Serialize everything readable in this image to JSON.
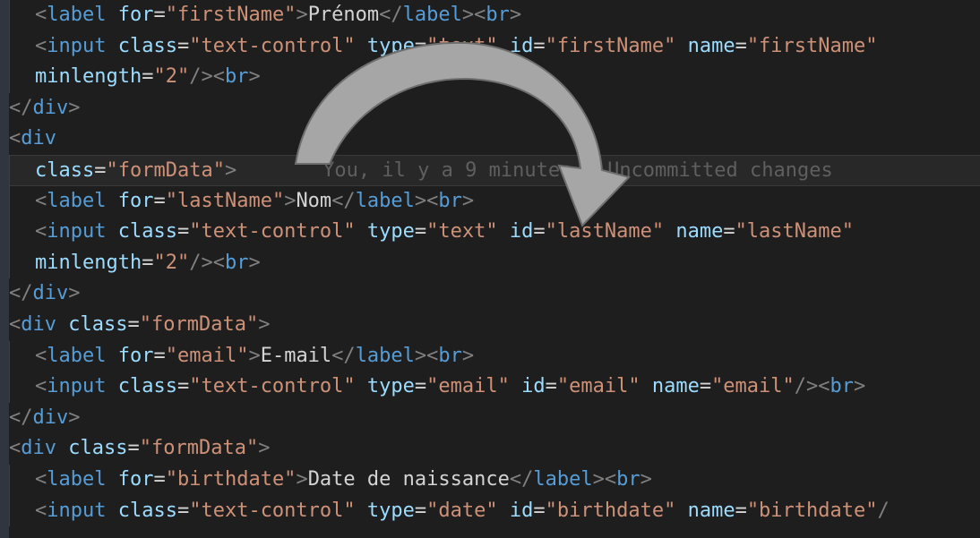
{
  "code": {
    "line1": {
      "label_for_attr": "for",
      "label_for_val": "\"firstName\"",
      "label_text": "Prénom"
    },
    "line2": {
      "input_class_attr": "class",
      "input_class_val": "\"text-control\"",
      "type_attr": "type",
      "type_val": "\"text\"",
      "id_attr": "id",
      "id_val": "\"firstName\"",
      "name_attr": "name",
      "name_val": "\"firstName\""
    },
    "line3": {
      "minlength_attr": "minlength",
      "minlength_val": "\"2\""
    },
    "line6": {
      "class_attr": "class",
      "class_val": "\"formData\""
    },
    "blame": "You, il y a 9 minutes • Uncommitted changes",
    "line7": {
      "for_val": "\"lastName\"",
      "label_text": "Nom"
    },
    "line8": {
      "id_val": "\"lastName\"",
      "name_val": "\"lastName\""
    },
    "line11": {
      "class_val": "\"formData\""
    },
    "line12": {
      "for_val": "\"email\"",
      "label_text": "E-mail"
    },
    "line13": {
      "type_val": "\"email\"",
      "id_val": "\"email\"",
      "name_val": "\"email\""
    },
    "line15": {
      "class_val": "\"formData\""
    },
    "line16": {
      "for_val": "\"birthdate\"",
      "label_text": "Date de naissance"
    },
    "line17": {
      "type_val": "\"date\"",
      "id_val": "\"birthdate\"",
      "name_val": "\"birthdate\""
    },
    "tags": {
      "label": "label",
      "input": "input",
      "br": "br",
      "div": "div"
    }
  },
  "colors": {
    "background": "#1e1e1e",
    "tag_bracket": "#808080",
    "tag_name": "#569cd6",
    "attr_name": "#9cdcfe",
    "attr_value": "#ce9178",
    "text": "#d4d4d4",
    "arrow_fill": "#9e9e9e"
  },
  "icons": {
    "arrow": "curved-arrow-icon"
  }
}
